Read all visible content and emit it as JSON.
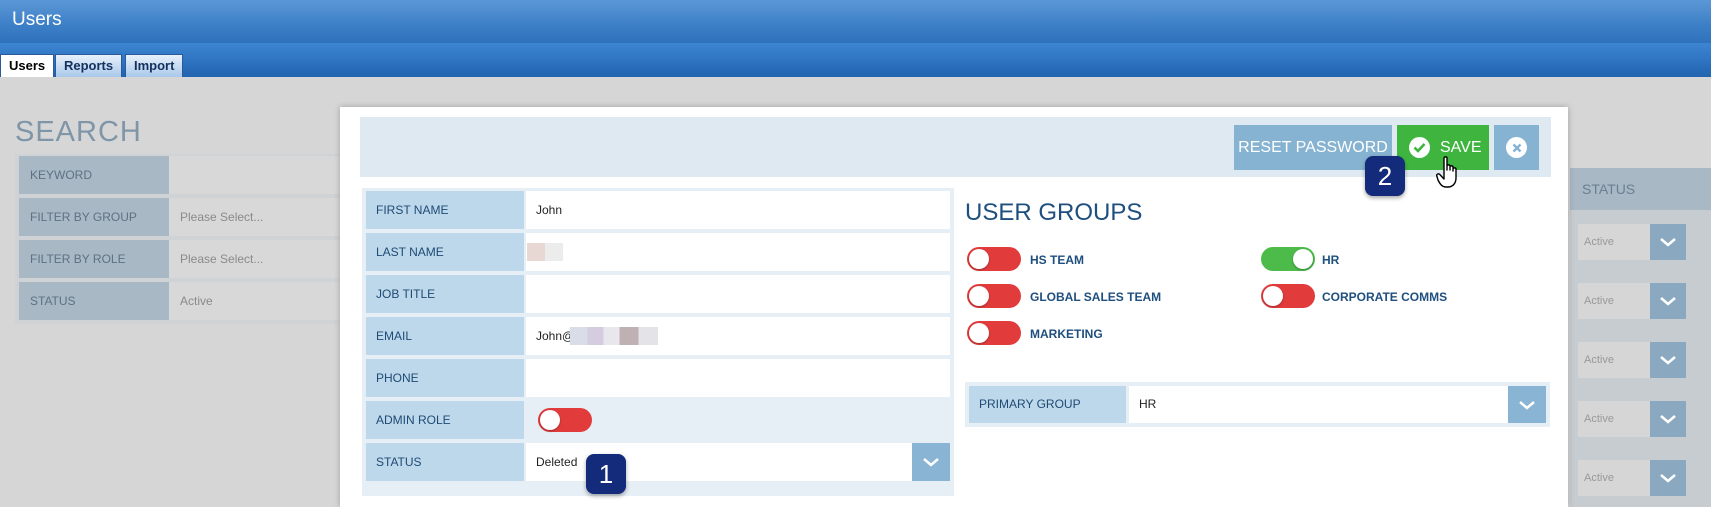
{
  "window": {
    "title": "Users"
  },
  "tabs": [
    {
      "label": "Users",
      "active": true
    },
    {
      "label": "Reports",
      "active": false
    },
    {
      "label": "Import",
      "active": false
    }
  ],
  "search": {
    "title": "SEARCH",
    "rows": [
      {
        "label": "KEYWORD",
        "value": ""
      },
      {
        "label": "FILTER BY GROUP",
        "value": "Please Select..."
      },
      {
        "label": "FILTER BY ROLE",
        "value": "Please Select..."
      },
      {
        "label": "STATUS",
        "value": "Active"
      }
    ]
  },
  "list": {
    "status_header": "STATUS",
    "rows": [
      {
        "status": "Active"
      },
      {
        "status": "Active"
      },
      {
        "status": "Active"
      },
      {
        "status": "Active"
      },
      {
        "status": "Active"
      }
    ]
  },
  "modal": {
    "reset_password_label": "RESET PASSWORD",
    "save_label": "SAVE",
    "fields": {
      "first_name": {
        "label": "FIRST NAME",
        "value": "John"
      },
      "last_name": {
        "label": "LAST NAME",
        "value": ""
      },
      "job_title": {
        "label": "JOB TITLE",
        "value": ""
      },
      "email": {
        "label": "EMAIL",
        "value": "John@"
      },
      "phone": {
        "label": "PHONE",
        "value": ""
      },
      "admin_role": {
        "label": "ADMIN ROLE",
        "on": false
      },
      "status": {
        "label": "STATUS",
        "value": "Deleted"
      }
    },
    "user_groups": {
      "title": "USER GROUPS",
      "items": [
        {
          "label": "HS TEAM",
          "on": false
        },
        {
          "label": "HR",
          "on": true
        },
        {
          "label": "GLOBAL SALES TEAM",
          "on": false
        },
        {
          "label": "CORPORATE COMMS",
          "on": false
        },
        {
          "label": "MARKETING",
          "on": false
        }
      ]
    },
    "primary_group": {
      "label": "PRIMARY GROUP",
      "value": "HR"
    }
  },
  "annotations": {
    "badge1": "1",
    "badge2": "2"
  },
  "colors": {
    "save": "#3fb540",
    "toggle_off": "#e23b3b",
    "toggle_on": "#4cbb4a",
    "accent": "#1e4f7e"
  }
}
